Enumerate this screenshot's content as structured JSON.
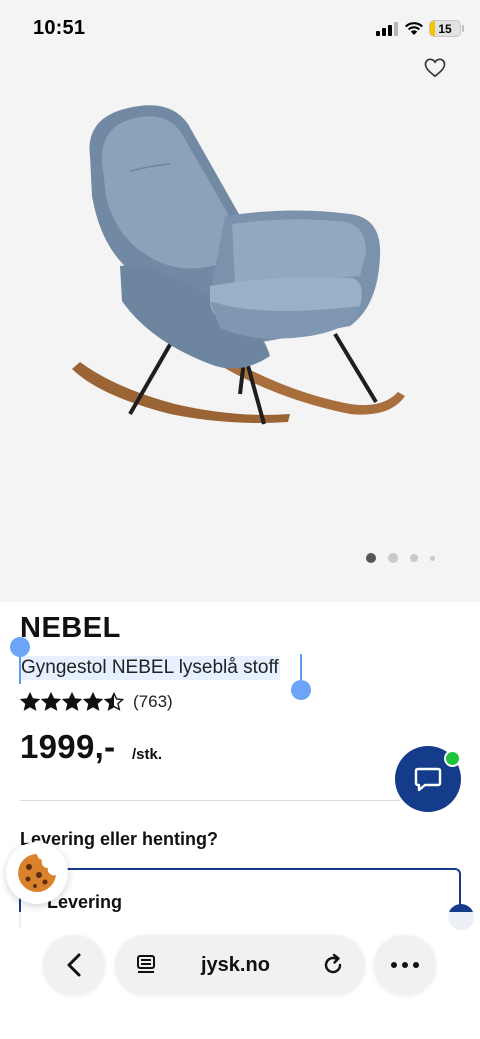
{
  "status_bar": {
    "time": "10:51",
    "battery_level": "15",
    "battery_fraction": 0.15,
    "battery_color": "#f5c400"
  },
  "gallery": {
    "image_icon": "rocking-chair-image",
    "slide_count": 4,
    "active_slide": 1
  },
  "product": {
    "name": "NEBEL",
    "description": "Gyngestol NEBEL lyseblå stoff",
    "rating": 4.5,
    "rating_max": 5,
    "review_count": "(763)",
    "price": "1999,-",
    "price_unit": "/stk."
  },
  "delivery": {
    "heading": "Levering eller henting?",
    "option_label": "Levering"
  },
  "browser": {
    "url": "jysk.no",
    "icons": [
      "back-icon",
      "reader-icon",
      "reload-icon",
      "more-icon"
    ]
  },
  "colors": {
    "brand_blue": "#143c8a",
    "online_green": "#1ec43c",
    "selection_blue": "#5b9bf5"
  }
}
